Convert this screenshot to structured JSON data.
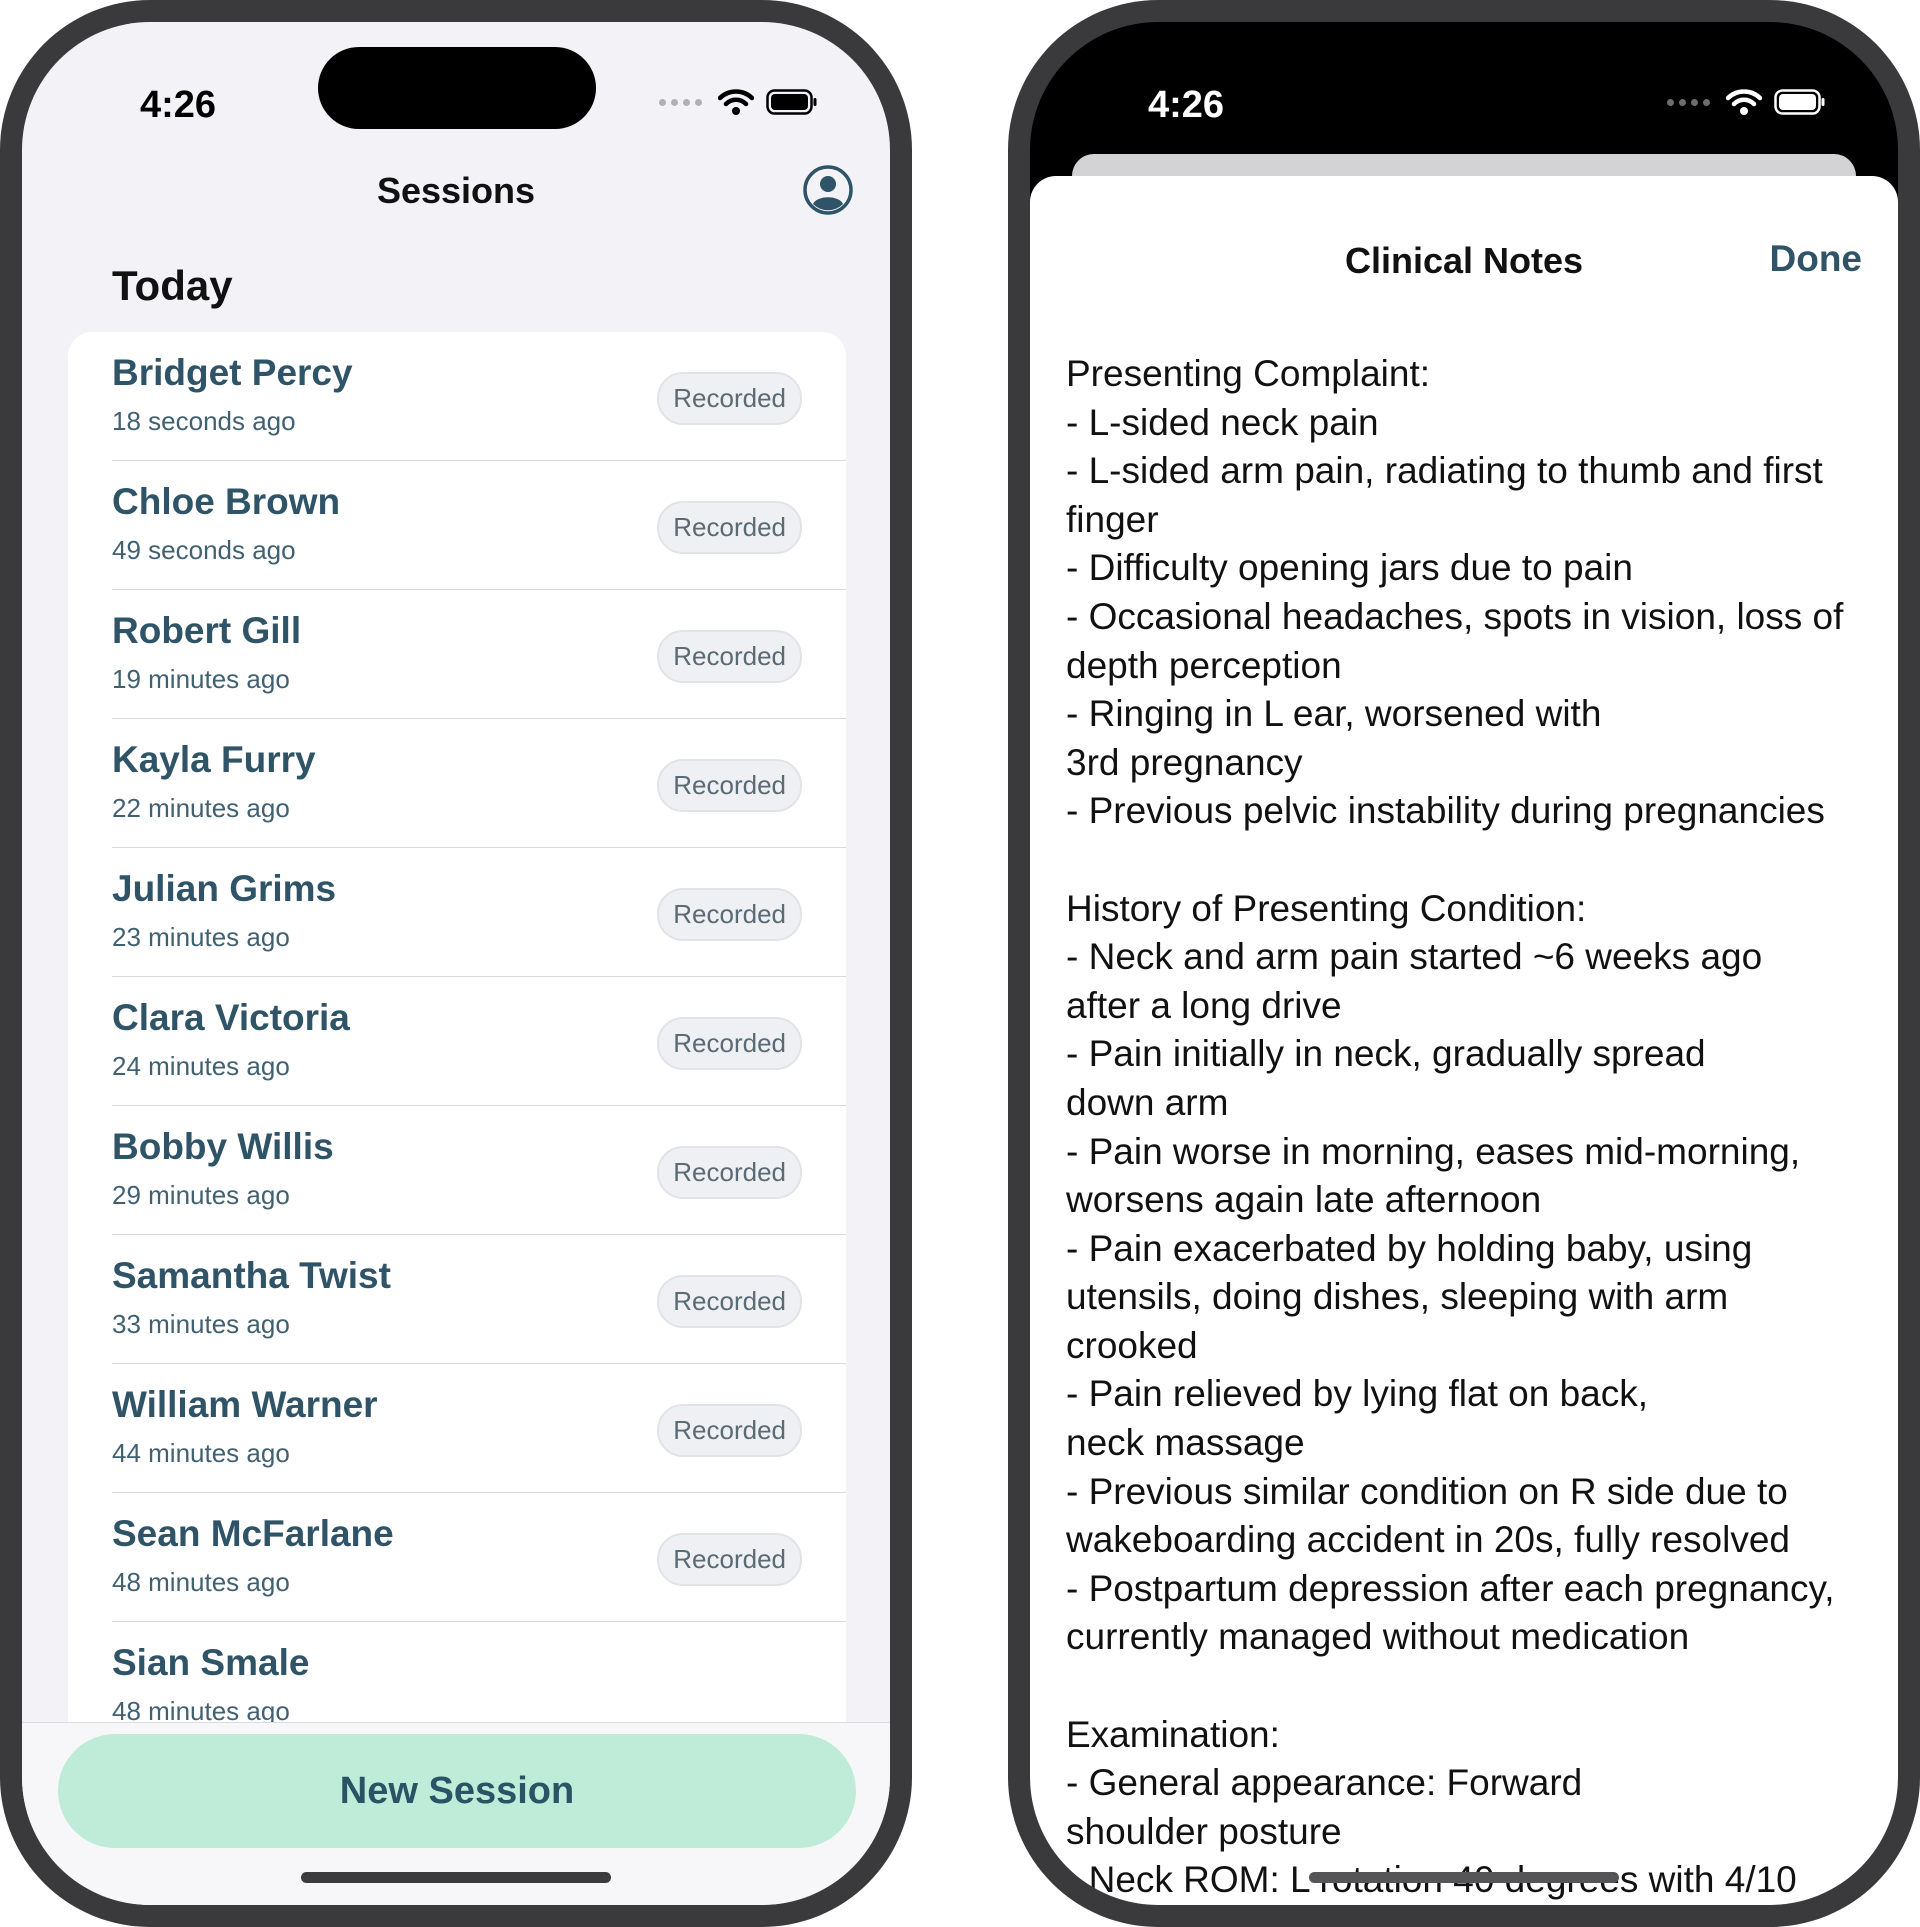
{
  "left_screen": {
    "status_bar": {
      "time": "4:26"
    },
    "nav": {
      "title": "Sessions",
      "profile_icon": "person-circle-icon"
    },
    "section_title": "Today",
    "sessions": [
      {
        "name": "Bridget Percy",
        "time": "18 seconds ago",
        "status": "Recorded"
      },
      {
        "name": "Chloe Brown",
        "time": "49 seconds ago",
        "status": "Recorded"
      },
      {
        "name": "Robert Gill",
        "time": "19 minutes ago",
        "status": "Recorded"
      },
      {
        "name": "Kayla Furry",
        "time": "22 minutes ago",
        "status": "Recorded"
      },
      {
        "name": "Julian Grims",
        "time": "23 minutes ago",
        "status": "Recorded"
      },
      {
        "name": "Clara Victoria",
        "time": "24 minutes ago",
        "status": "Recorded"
      },
      {
        "name": "Bobby Willis",
        "time": "29 minutes ago",
        "status": "Recorded"
      },
      {
        "name": "Samantha Twist",
        "time": "33 minutes ago",
        "status": "Recorded"
      },
      {
        "name": "William Warner",
        "time": "44 minutes ago",
        "status": "Recorded"
      },
      {
        "name": "Sean McFarlane",
        "time": "48 minutes ago",
        "status": "Recorded"
      },
      {
        "name": "Sian Smale",
        "time": "48 minutes ago",
        "status": ""
      }
    ],
    "new_session_label": "New Session"
  },
  "right_screen": {
    "status_bar": {
      "time": "4:26"
    },
    "sheet": {
      "title": "Clinical Notes",
      "done_label": "Done"
    },
    "notes": [
      {
        "heading": "Presenting Complaint:",
        "lines": [
          "- L-sided neck pain",
          "- L-sided arm pain, radiating to thumb and first finger",
          "- Difficulty opening jars due to pain",
          "- Occasional headaches, spots in vision, loss of depth perception",
          "- Ringing in L ear, worsened with\n3rd pregnancy",
          "- Previous pelvic instability during pregnancies"
        ]
      },
      {
        "heading": "History of Presenting Condition:",
        "lines": [
          "- Neck and arm pain started ~6 weeks ago\nafter a long drive",
          "- Pain initially in neck, gradually spread\ndown arm",
          "- Pain worse in morning, eases mid-morning, worsens again late afternoon",
          "- Pain exacerbated by holding baby, using utensils, doing dishes, sleeping with arm crooked",
          "- Pain relieved by lying flat on back,\nneck massage",
          "- Previous similar condition on R side due to wakeboarding accident in 20s, fully resolved",
          "- Postpartum depression after each pregnancy, currently managed without medication"
        ]
      },
      {
        "heading": "Examination:",
        "lines": [
          "- General appearance: Forward\nshoulder posture",
          "- Neck ROM: L rotation 40 degrees with 4/10"
        ]
      }
    ]
  },
  "colors": {
    "accent_text": "#2f5468",
    "button_fill": "#bfecd8",
    "badge_fill": "#eff0f4"
  }
}
